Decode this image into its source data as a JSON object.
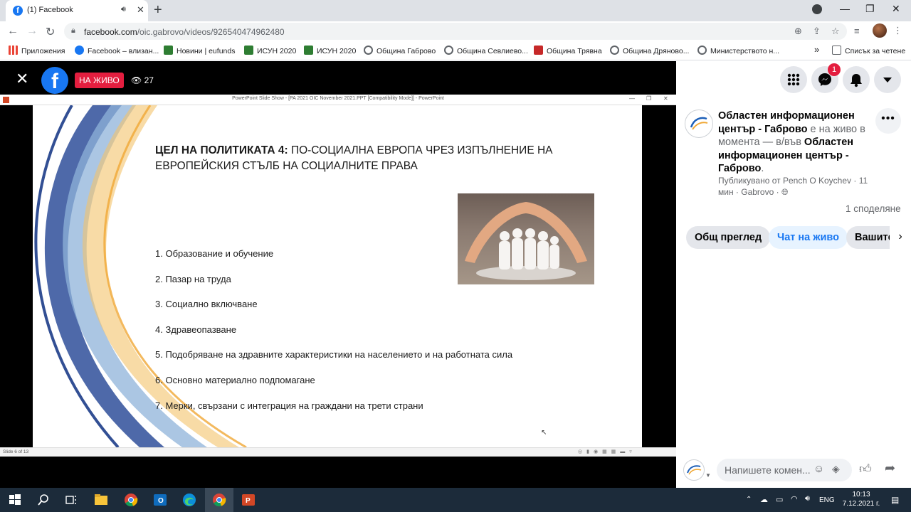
{
  "browser": {
    "tab_title": "(1) Facebook",
    "url_host": "facebook.com",
    "url_path": "/oic.gabrovo/videos/926540474962480"
  },
  "bookmarks": [
    {
      "label": "Приложения",
      "color": "#ea4335"
    },
    {
      "label": "Facebook – влизан...",
      "color": "#1877f2"
    },
    {
      "label": "Новини | eufunds",
      "color": "#2e7d32"
    },
    {
      "label": "ИСУН 2020",
      "color": "#2e7d32"
    },
    {
      "label": "ИСУН 2020",
      "color": "#2e7d32"
    },
    {
      "label": "Община Габрово",
      "color": "#5f6368"
    },
    {
      "label": "Община Севлиево...",
      "color": "#5f6368"
    },
    {
      "label": "Община Трявна",
      "color": "#c62828"
    },
    {
      "label": "Община Дряново...",
      "color": "#5f6368"
    },
    {
      "label": "Министерството н...",
      "color": "#5f6368"
    }
  ],
  "reading_list": "Списък за четене",
  "video": {
    "live_label": "НА ЖИВО",
    "viewer_count": "27",
    "ppt_window_title": "PowerPoint Slide Show - [PA 2021 OIC November 2021.PPT [Compatibility Mode]] - PowerPoint",
    "ppt_status": "Slide 6 of 13",
    "slide": {
      "heading_bold": "ЦЕЛ НА ПОЛИТИКАТА 4:",
      "heading_rest": " ПО-СОЦИАЛНА ЕВРОПА ЧРЕЗ ИЗПЪЛНЕНИЕ НА ЕВРОПЕЙСКИЯ СТЪЛБ НА СОЦИАЛНИТЕ ПРАВА",
      "items": [
        "1. Образование и обучение",
        "2. Пазар на труда",
        "3. Социално включване",
        "4. Здравеопазване",
        "5. Подобряване на здравните характеристики на населението и на работната сила",
        "6. Основно материално подпомагане",
        "7. Мерки, свързани с интеграция на граждани на трети страни"
      ]
    }
  },
  "panel": {
    "messenger_badge": "1",
    "post": {
      "page_name_1": "Областен информационен център - Габрово",
      "middle": " е на живо в момента — в/във ",
      "page_name_2": "Областен информационен център - Габрово",
      "end": ".",
      "meta": "Публикувано от Pench O Koychev · 11 мин · Gabrovo ·"
    },
    "shares": "1 споделяне",
    "tabs": {
      "overview": "Общ преглед",
      "live_chat": "Чат на живо",
      "yours": "Вашите"
    },
    "comment_placeholder": "Напишете комен..."
  },
  "taskbar": {
    "lang": "ENG",
    "time": "10:13",
    "date": "7.12.2021 г."
  }
}
